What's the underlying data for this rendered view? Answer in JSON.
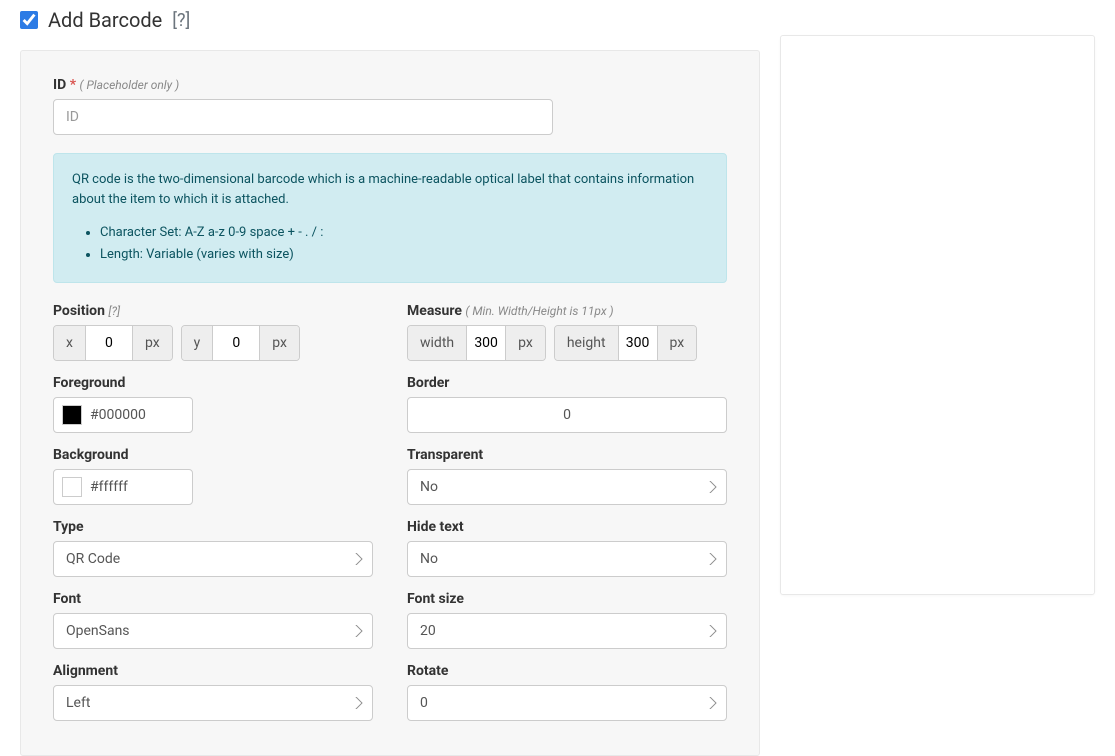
{
  "header": {
    "checked": true,
    "title": "Add Barcode",
    "help": "[?]"
  },
  "id_field": {
    "label": "ID",
    "required_mark": "*",
    "hint": "( Placeholder only )",
    "placeholder": "ID",
    "value": ""
  },
  "info": {
    "text": "QR code is the two-dimensional barcode which is a machine-readable optical label that contains information about the item to which it is attached.",
    "bullets": [
      "Character Set: A-Z a-z 0-9 space + - . / :",
      "Length: Variable (varies with size)"
    ]
  },
  "position": {
    "label": "Position",
    "help": "[?]",
    "x_label": "x",
    "x_value": "0",
    "x_unit": "px",
    "y_label": "y",
    "y_value": "0",
    "y_unit": "px"
  },
  "measure": {
    "label": "Measure",
    "hint": "( Min. Width/Height is 11px )",
    "width_label": "width",
    "width_value": "300",
    "width_unit": "px",
    "height_label": "height",
    "height_value": "300",
    "height_unit": "px"
  },
  "foreground": {
    "label": "Foreground",
    "value": "#000000"
  },
  "background": {
    "label": "Background",
    "value": "#ffffff"
  },
  "type_field": {
    "label": "Type",
    "value": "QR Code"
  },
  "font_field": {
    "label": "Font",
    "value": "OpenSans"
  },
  "alignment": {
    "label": "Alignment",
    "value": "Left"
  },
  "border": {
    "label": "Border",
    "value": "0"
  },
  "transparent": {
    "label": "Transparent",
    "value": "No"
  },
  "hide_text": {
    "label": "Hide text",
    "value": "No"
  },
  "font_size": {
    "label": "Font size",
    "value": "20"
  },
  "rotate": {
    "label": "Rotate",
    "value": "0"
  }
}
